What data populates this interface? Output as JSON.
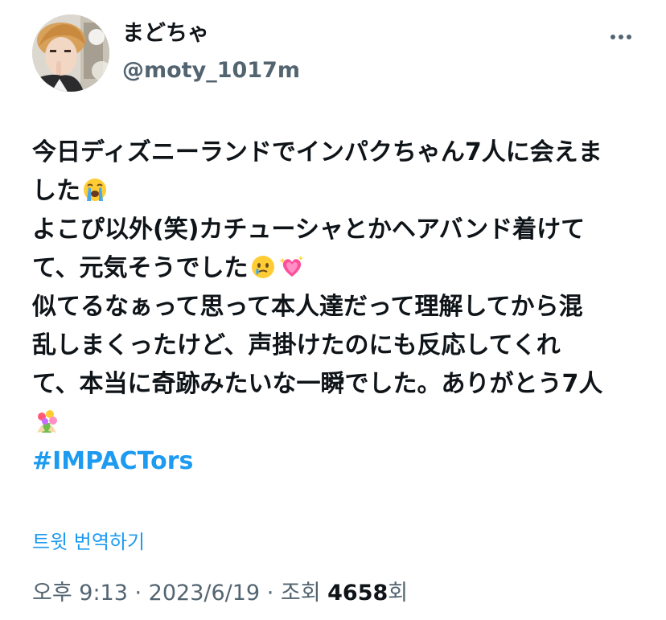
{
  "user": {
    "display_name": "まどちゃ",
    "handle": "@moty_1017m",
    "more_icon": "ellipsis-icon"
  },
  "tweet": {
    "lines": [
      "今日ディズニーランドでインパクちゃん7人に会えま",
      "した",
      "よこぴ以外(笑)カチューシャとかヘアバンド着けて",
      "て、元気そうでした",
      "似てるなぁって思って本人達だって理解してから混",
      "乱しまくったけど、声掛けたのにも反応してくれ",
      "て、本当に奇跡みたいな一瞬でした。ありがとう7人"
    ],
    "emojis": {
      "crying": "loudly-crying-face-emoji",
      "holding_tears": "face-holding-back-tears-emoji",
      "sparkling_heart": "sparkling-heart-emoji",
      "bouquet": "bouquet-emoji"
    },
    "hashtag": "#IMPACTors"
  },
  "translate_label": "트윗 번역하기",
  "meta": {
    "time": "오후 9:13",
    "separator": " · ",
    "date": "2023/6/19",
    "views_label": "조회",
    "views_count": "4658",
    "views_suffix": "회"
  },
  "colors": {
    "link": "#1d9bf0",
    "text": "#0f1419",
    "secondary": "#536471",
    "background": "#ffffff"
  }
}
